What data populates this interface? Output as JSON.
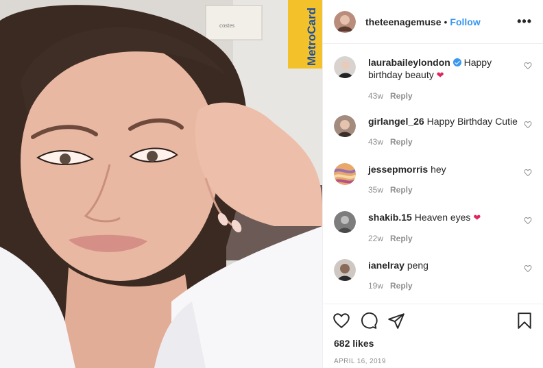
{
  "post": {
    "username": "theteenagemuse",
    "follow_label": "Follow",
    "separator": "•",
    "more_label": "•••",
    "likes": "682 likes",
    "date": "APRIL 16, 2019"
  },
  "photo": {
    "sign_brand": "MetroCard",
    "card_text": "costes"
  },
  "comments": [
    {
      "user": "laurabaileylondon",
      "text": "Happy birthday beauty",
      "heart": "❤",
      "time": "43w",
      "reply": "Reply",
      "verified": true
    },
    {
      "user": "girlangel_26",
      "text": "Happy Birthday Cutie",
      "heart": "",
      "time": "43w",
      "reply": "Reply"
    },
    {
      "user": "jessepmorris",
      "text": "hey",
      "heart": "",
      "time": "35w",
      "reply": "Reply"
    },
    {
      "user": "shakib.15",
      "text": "Heaven eyes",
      "heart": "❤",
      "time": "22w",
      "reply": "Reply"
    },
    {
      "user": "ianelray",
      "text": "peng",
      "heart": "",
      "time": "19w",
      "reply": "Reply"
    }
  ],
  "colors": {
    "follow": "#3897f0",
    "heart": "#e0245e",
    "muted": "#8e8e8e"
  },
  "icons": [
    "heart-icon",
    "comment-icon",
    "share-icon",
    "bookmark-icon",
    "more-icon"
  ]
}
